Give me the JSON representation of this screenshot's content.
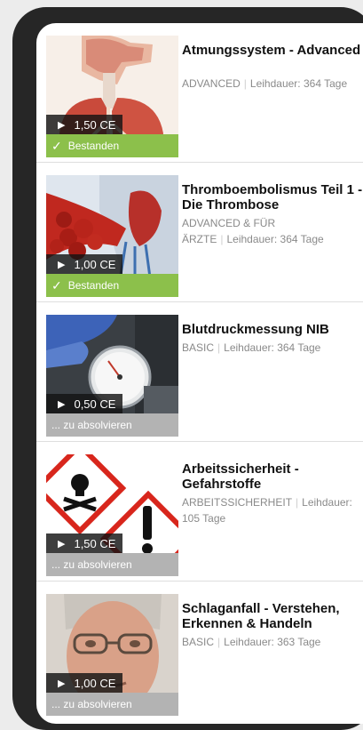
{
  "courses": [
    {
      "title": "Atmungssystem - Advanced",
      "category": "ADVANCED",
      "loan_label": "Leihdauer: 364 Tage",
      "ce_label": "1,50 CE",
      "status_label": "Bestanden",
      "status_type": "passed",
      "image": "respiratory-system-image"
    },
    {
      "title": "Thromboembolismus Teil 1 - Die Thrombose",
      "category": "ADVANCED & FÜR ÄRZTE",
      "loan_label": "Leihdauer: 364 Tage",
      "ce_label": "1,00 CE",
      "status_label": "Bestanden",
      "status_type": "passed",
      "image": "thrombosis-image"
    },
    {
      "title": "Blutdruckmessung NIB",
      "category": "BASIC",
      "loan_label": "Leihdauer: 364 Tage",
      "ce_label": "0,50 CE",
      "status_label": "... zu absolvieren",
      "status_type": "pending",
      "image": "blood-pressure-image"
    },
    {
      "title": "Arbeitssicherheit - Gefahrstoffe",
      "category": "ARBEITSSICHERHEIT",
      "loan_label": "Leihdauer: 105 Tage",
      "ce_label": "1,50 CE",
      "status_label": "... zu absolvieren",
      "status_type": "pending",
      "image": "hazard-symbols-image"
    },
    {
      "title": "Schlaganfall - Verstehen, Erkennen & Handeln",
      "category": "BASIC",
      "loan_label": "Leihdauer: 363 Tage",
      "ce_label": "1,00 CE",
      "status_label": "... zu absolvieren",
      "status_type": "pending",
      "image": "elderly-man-image"
    }
  ],
  "colors": {
    "passed": "#8cc04b",
    "pending": "#b3b3b3"
  }
}
